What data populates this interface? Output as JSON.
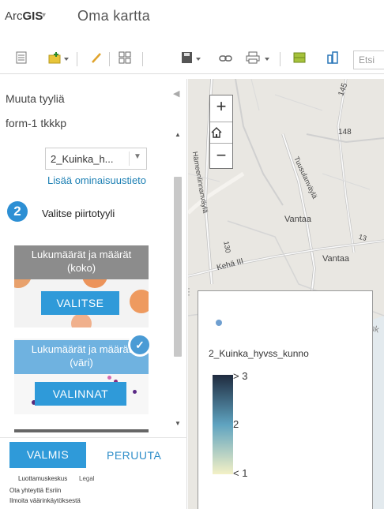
{
  "app": {
    "brand_prefix": "Arc",
    "brand_bold": "GIS",
    "brand_caret": "▾",
    "map_title": "Oma kartta"
  },
  "toolbar": {
    "search_placeholder": "Etsi"
  },
  "panel": {
    "title": "Muuta tyyliä",
    "layer_name": "form-1 tkkkp",
    "attribute_value": "2_Kuinka_h...",
    "add_attribute_link": "Lisää ominaisuustieto",
    "step_number": "2",
    "step_label": "Valitse piirtotyyli",
    "styles": [
      {
        "title_line1": "Lukumäärät ja määrät",
        "title_line2": "(koko)",
        "button": "VALITSE"
      },
      {
        "title_line1": "Lukumäärät ja määrät",
        "title_line2": "(väri)",
        "button": "VALINNAT",
        "selected": true
      }
    ],
    "done_button": "VALMIS",
    "cancel_button": "PERUUTA"
  },
  "footer": {
    "trust_center": "Luottamuskeskus",
    "legal": "Legal",
    "contact": "Ota yhteyttä Esriin",
    "report_abuse": "Ilmoita väärinkäytöksestä"
  },
  "map": {
    "labels": {
      "road_145": "145",
      "road_148": "148",
      "hameenlinnanvayla": "Hämeenlinnanväylä",
      "tuusulanvayla": "Tuusulanväylä",
      "vantaa_1": "Vantaa",
      "vantaa_2": "Vantaa",
      "road_130": "130",
      "road_13": "13",
      "kehaiii": "Kehä III",
      "helsinki": "Helsink"
    },
    "zoom_in": "+",
    "zoom_out": "−"
  },
  "legend": {
    "field": "2_Kuinka_hyvss_kunno",
    "max_label": "> 3",
    "mid_label": "2",
    "min_label": "< 1"
  }
}
